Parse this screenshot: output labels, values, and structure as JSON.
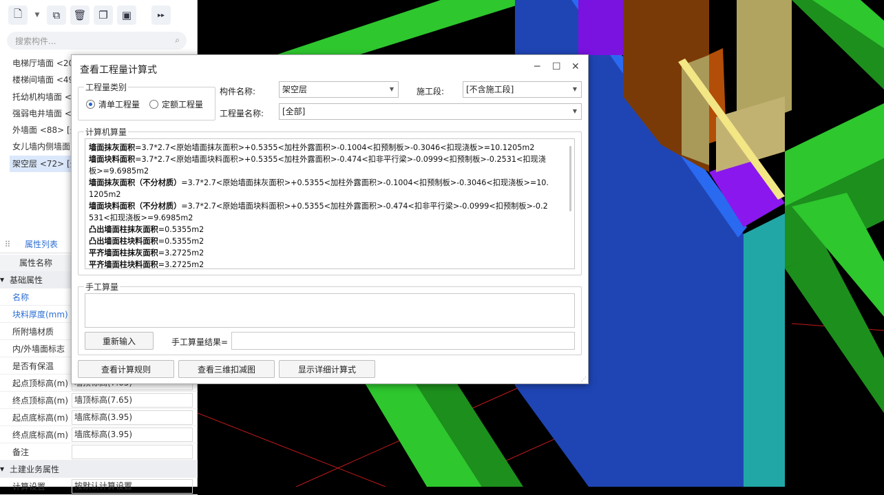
{
  "left_panel": {
    "toolbar": [
      "new-icon",
      "copy-icon",
      "delete-icon",
      "duplicate-icon",
      "layer-copy-icon",
      "more-icon"
    ],
    "search_placeholder": "搜索构件...",
    "tree_items": [
      "电梯厅墙面 <20",
      "楼梯间墙面 <49",
      "托幼机构墙面 <",
      "强弱电井墙面 <",
      "外墙面 <88> [外",
      "女儿墙内侧墙面",
      "架空层 <72> [外"
    ],
    "props_tab": "属性列表",
    "props_col_header": "属性名称",
    "prop_rows": [
      {
        "name": "基础属性",
        "value": "",
        "group": true
      },
      {
        "name": "名称",
        "value": "",
        "blue": true
      },
      {
        "name": "块料厚度(mm)",
        "value": "",
        "blue": true
      },
      {
        "name": "所附墙材质",
        "value": ""
      },
      {
        "name": "内/外墙面标志",
        "value": ""
      },
      {
        "name": "是否有保温",
        "value": ""
      },
      {
        "name": "起点顶标高(m)",
        "value": "墙顶标高(7.65)"
      },
      {
        "name": "终点顶标高(m)",
        "value": "墙顶标高(7.65)"
      },
      {
        "name": "起点底标高(m)",
        "value": "墙底标高(3.95)"
      },
      {
        "name": "终点底标高(m)",
        "value": "墙底标高(3.95)"
      },
      {
        "name": "备注",
        "value": ""
      },
      {
        "name": "土建业务属性",
        "value": "",
        "group": true
      },
      {
        "name": "计算设置",
        "value": "按默认计算设置"
      }
    ]
  },
  "dialog": {
    "title": "查看工程量计算式",
    "controls": {
      "minimize": "─",
      "maximize": "☐",
      "close": "✕"
    },
    "quantity_type_label": "工程量类别",
    "radio_bill": "清单工程量",
    "radio_quota": "定额工程量",
    "component_name_label": "构件名称:",
    "component_name_value": "架空层",
    "stage_label": "施工段:",
    "stage_value": "[不含施工段]",
    "quantity_name_label": "工程量名称:",
    "quantity_name_value": "[全部]",
    "computer_calc_label": "计算机算量",
    "calc_lines": [
      {
        "name": "墙面抹灰面积",
        "formula": "=3.7*2.7<原始墙面抹灰面积>+0.5355<加柱外露面积>-0.1004<扣预制板>-0.3046<扣现浇板>=10.1205m2"
      },
      {
        "name": "墙面块料面积",
        "formula": "=3.7*2.7<原始墙面块料面积>+0.5355<加柱外露面积>-0.474<扣非平行梁>-0.0999<扣预制板>-0.2531<扣现浇"
      },
      {
        "name": "",
        "formula": "板>=9.6985m2"
      },
      {
        "name": "墙面抹灰面积（不分材质）",
        "formula": "=3.7*2.7<原始墙面抹灰面积>+0.5355<加柱外露面积>-0.1004<扣预制板>-0.3046<扣现浇板>=10."
      },
      {
        "name": "",
        "formula": "1205m2"
      },
      {
        "name": "墙面块料面积（不分材质）",
        "formula": "=3.7*2.7<原始墙面块料面积>+0.5355<加柱外露面积>-0.474<扣非平行梁>-0.0999<扣预制板>-0.2"
      },
      {
        "name": "",
        "formula": "531<扣现浇板>=9.6985m2"
      },
      {
        "name": "凸出墙面柱抹灰面积",
        "formula": "=0.5355m2"
      },
      {
        "name": "凸出墙面柱块料面积",
        "formula": "=0.5355m2"
      },
      {
        "name": "平齐墙面柱抹灰面积",
        "formula": "=3.2725m2"
      },
      {
        "name": "平齐墙面柱块料面积",
        "formula": "=3.2725m2"
      }
    ],
    "manual_calc_label": "手工算量",
    "reenter_button": "重新输入",
    "manual_result_label": "手工算量结果=",
    "view_rules_button": "查看计算规则",
    "view_3d_button": "查看三维扣减图",
    "show_detail_button": "显示详细计算式"
  },
  "colors": {
    "accent": "#2563c9",
    "selected_bg": "#dbe8fb",
    "beam_green": "#2ec72e",
    "wall_blue": "#1f45b5",
    "teal": "#22a7a7",
    "purple": "#7a12e0",
    "arrow_red": "#e8221b"
  }
}
